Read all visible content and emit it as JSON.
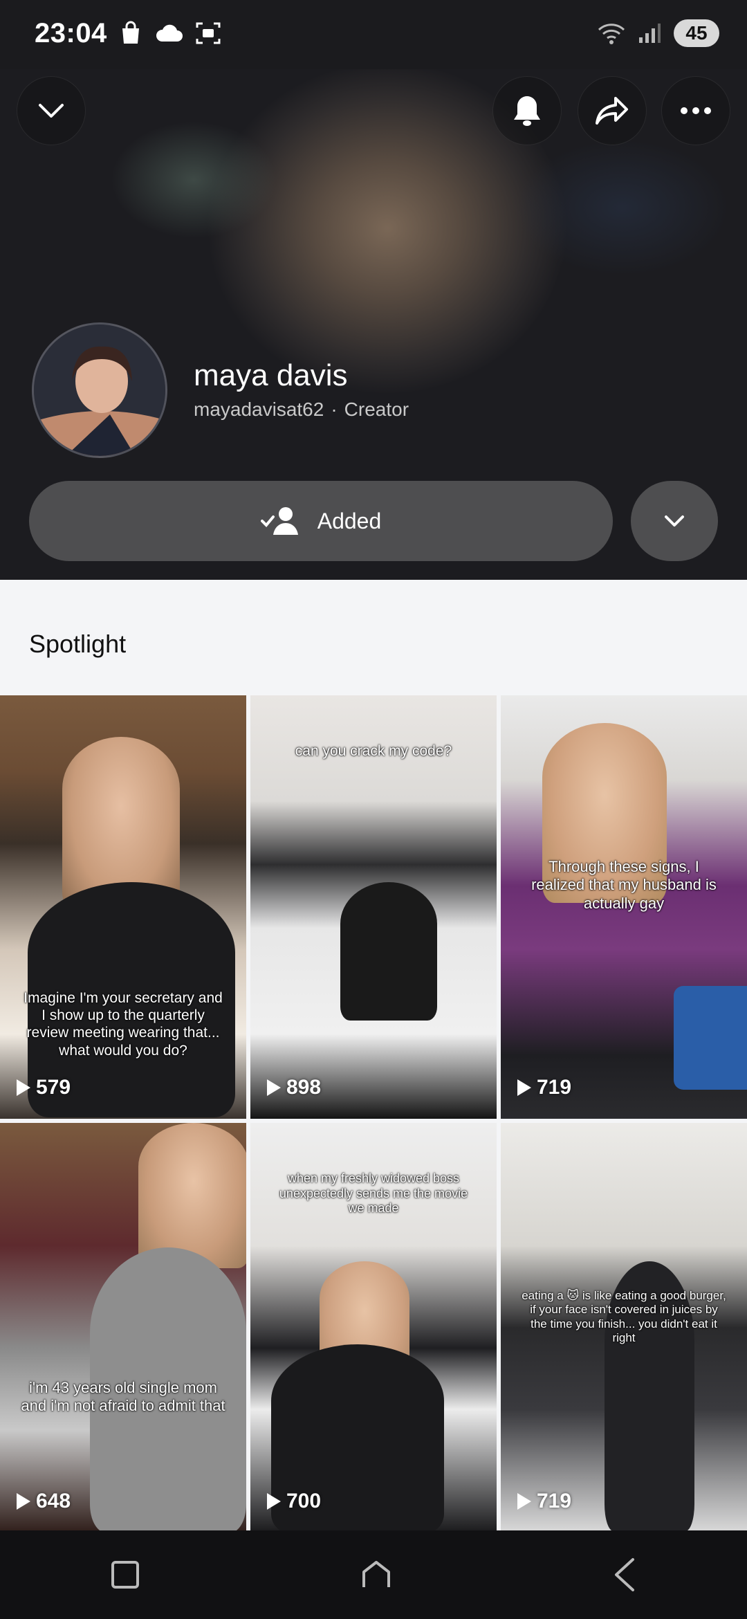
{
  "status_bar": {
    "time": "23:04",
    "battery": "45",
    "icons": [
      "shopping-bag-icon",
      "cloud-icon",
      "screenshot-icon",
      "wifi-icon",
      "signal-icon"
    ]
  },
  "profile": {
    "name": "maya davis",
    "username": "mayadavisat62",
    "separator": "·",
    "role": "Creator",
    "added_label": "Added"
  },
  "section": {
    "title": "Spotlight"
  },
  "spotlight": [
    {
      "caption": "Imagine I'm your secretary and I show up to the quarterly review meeting wearing that... what would you do?",
      "views": "579"
    },
    {
      "caption": "can you crack my code?",
      "views": "898"
    },
    {
      "caption": "Through these signs, I realized that my husband is actually gay",
      "views": "719"
    },
    {
      "caption": "i'm 43 years old single mom and i'm not afraid to admit that",
      "views": "648"
    },
    {
      "caption": "when my freshly widowed boss unexpectedly sends me the movie we made",
      "views": "700"
    },
    {
      "caption": "eating a 🐱 is like eating a good burger, if your face isn't covered in juices by the time you finish... you didn't eat it right",
      "views": "719"
    }
  ],
  "colors": {
    "header_bg": "#1c1c20",
    "page_bg": "#f4f5f7",
    "button_bg": "#787878"
  }
}
